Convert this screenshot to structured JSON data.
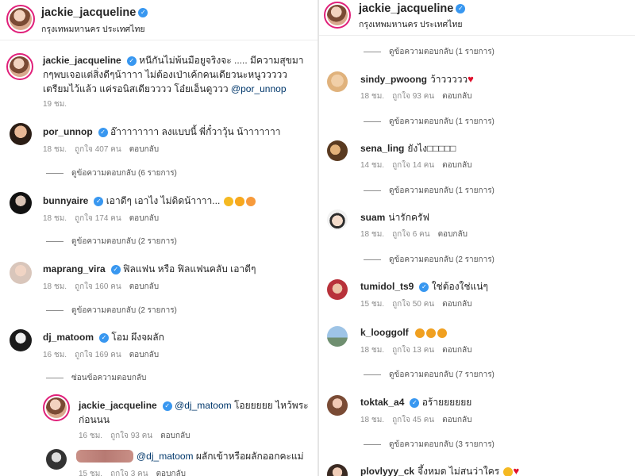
{
  "left": {
    "header": {
      "username": "jackie_jacqueline",
      "location": "กรุงเทพมหานคร ประเทศไทย"
    },
    "caption": {
      "username": "jackie_jacqueline",
      "text": "หนีกันไม่พ้นมือยูจริงจะ ..... มีความสุขมากๆพบเจอแต่สิ่งดีๆน้าาาา ไม่ต้องเป่าเค้กคนเดียวนะหนูววววว เตรียมไว้แล้ว แค่รอนิสเดียวววว โอ๋ยเอ็นดูววว",
      "mention": "@por_unnop",
      "time": "19 ชม."
    },
    "comments": [
      {
        "username": "por_unnop",
        "text": "อ๊าาาาาาาา ลงแบบนี้ พี่กั๋วาวุ้น น้าาาาาาา",
        "time": "18 ชม.",
        "likes": "ถูกใจ 407 คน",
        "reply": "ตอบกลับ",
        "view_replies": "ดูข้อความตอบกลับ (6 รายการ)"
      },
      {
        "username": "bunnyaire",
        "text": "เอาดีๆ เอาไง ไม่ดิดน้าาาา...",
        "time": "18 ชม.",
        "likes": "ถูกใจ 174 คน",
        "reply": "ตอบกลับ",
        "view_replies": "ดูข้อความตอบกลับ (2 รายการ)"
      },
      {
        "username": "maprang_vira",
        "text": "ฟิลแฟน หรือ ฟิลแฟนคลับ เอาดีๆ",
        "time": "18 ชม.",
        "likes": "ถูกใจ 160 คน",
        "reply": "ตอบกลับ",
        "view_replies": "ดูข้อความตอบกลับ (2 รายการ)"
      },
      {
        "username": "dj_matoom",
        "text": "โอม ผึงจผลัก",
        "time": "16 ชม.",
        "likes": "ถูกใจ 169 คน",
        "reply": "ตอบกลับ",
        "view_replies": "ซ่อนข้อความตอบกลับ"
      }
    ],
    "nested_replies": [
      {
        "username": "jackie_jacqueline",
        "mention": "@dj_matoom",
        "text": "โอยยยยย ไหว้พระก่อนนน",
        "time": "16 ชม.",
        "likes": "ถูกใจ 93 คน",
        "reply": "ตอบกลับ"
      },
      {
        "mention": "@dj_matoom",
        "text": "ผลักเข้าหรือผลักออกคะแม่",
        "time": "15 ชม.",
        "likes": "ถูกใจ 3 คน",
        "reply": "ตอบกลับ"
      }
    ]
  },
  "right": {
    "header": {
      "username": "jackie_jacqueline",
      "location": "กรุงเทพมหานคร ประเทศไทย"
    },
    "top_view_replies": "ดูข้อความตอบกลับ (1 รายการ)",
    "comments": [
      {
        "username": "sindy_pwoong",
        "text": "ว้าววววว",
        "time": "18 ชม.",
        "likes": "ถูกใจ 93 คน",
        "reply": "ตอบกลับ",
        "view_replies": "ดูข้อความตอบกลับ (1 รายการ)"
      },
      {
        "username": "sena_ling",
        "text": "ยังไง□□□□□",
        "time": "14 ชม.",
        "likes": "ถูกใจ 14 คน",
        "reply": "ตอบกลับ",
        "view_replies": "ดูข้อความตอบกลับ (1 รายการ)"
      },
      {
        "username": "suam",
        "text": "น่ารักครัฟ",
        "time": "18 ชม.",
        "likes": "ถูกใจ 6 คน",
        "reply": "ตอบกลับ",
        "view_replies": "ดูข้อความตอบกลับ (2 รายการ)"
      },
      {
        "username": "tumidol_ts9",
        "text": "ใช่ต้องใช่แน่ๆ",
        "time": "15 ชม.",
        "likes": "ถูกใจ 50 คน",
        "reply": "ตอบกลับ",
        "view_replies": ""
      },
      {
        "username": "k_looggolf",
        "text": "",
        "time": "18 ชม.",
        "likes": "ถูกใจ 13 คน",
        "reply": "ตอบกลับ",
        "view_replies": "ดูข้อความตอบกลับ (7 รายการ)"
      },
      {
        "username": "toktak_a4",
        "text": "อร้ายยยยยย",
        "time": "18 ชม.",
        "likes": "ถูกใจ 45 คน",
        "reply": "ตอบกลับ",
        "view_replies": "ดูข้อความตอบกลับ (3 รายการ)"
      },
      {
        "username": "plovlyyy_ck",
        "text": "จึ้งหมด ไม่สนว่าใคร",
        "time": "",
        "likes": "",
        "reply": "",
        "view_replies": ""
      }
    ]
  },
  "colors": {
    "verified": "#3897f0",
    "story_ring": "#e0207a",
    "heart": "#e0102c",
    "meta": "#8e8e8e",
    "mention": "#00376b"
  }
}
